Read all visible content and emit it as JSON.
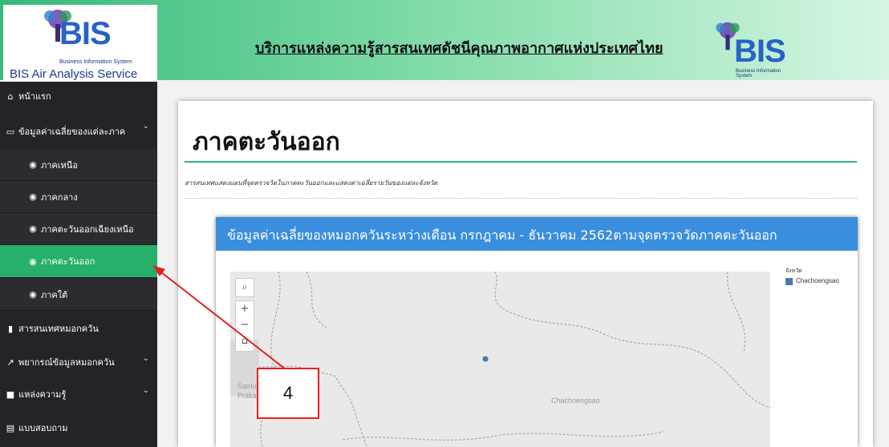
{
  "header": {
    "logo_text": "BIS",
    "logo_sub": "Business Information System",
    "app_name": "BIS Air Analysis Service",
    "title": "บริการแหล่งความรู้สารสนเทศดัชนีคุณภาพอากาศแห่งประเทศไทย",
    "right_logo_text": "BIS",
    "right_logo_sub": "Business Information System"
  },
  "sidebar": {
    "items": [
      {
        "label": "หน้าแรก",
        "icon": "home-icon"
      },
      {
        "label": "ข้อมูลค่าเฉลี่ยของแต่ละภาค",
        "icon": "monitor-icon",
        "expanded": true
      },
      {
        "label": "ภาคเหนือ",
        "icon": "compass-icon"
      },
      {
        "label": "ภาคกลาง",
        "icon": "compass-icon"
      },
      {
        "label": "ภาคตะวันออกเฉียงเหนือ",
        "icon": "compass-icon"
      },
      {
        "label": "ภาคตะวันออก",
        "icon": "compass-icon",
        "active": true
      },
      {
        "label": "ภาคใต้",
        "icon": "compass-icon"
      },
      {
        "label": "สารสนเทศหมอกควัน",
        "icon": "bar-chart-icon"
      },
      {
        "label": "พยากรณ์ข้อมูลหมอกควัน",
        "icon": "line-chart-icon"
      },
      {
        "label": "แหล่งความรู้",
        "icon": "book-icon"
      },
      {
        "label": "แบบสอบถาม",
        "icon": "form-icon"
      }
    ]
  },
  "main": {
    "page_title": "ภาคตะวันออก",
    "description": "สารสนเทศแสดงแผนที่จุดตรวจวัดในภาคตะวันออกและแสดงค่าเฉลี่ยรายวันของแต่ละจังหวัด",
    "panel_title": "ข้อมูลค่าเฉลี่ยของหมอกควันระหว่างเดือน กรกฎาคม - ธันวาคม 2562ตามจุดตรวจวัดภาคตะวันออก",
    "map": {
      "labels": [
        "Samut",
        "Prakarn",
        "Chachoengsao"
      ],
      "controls": {
        "search": "⌕",
        "zoom_in": "+",
        "zoom_out": "−",
        "home": "⌂"
      }
    },
    "legend": {
      "title": "จังหวัด",
      "item": "Chachoengsao",
      "color": "#4a79a5"
    }
  },
  "annotation": {
    "callout_text": "4",
    "color": "#e32020"
  }
}
